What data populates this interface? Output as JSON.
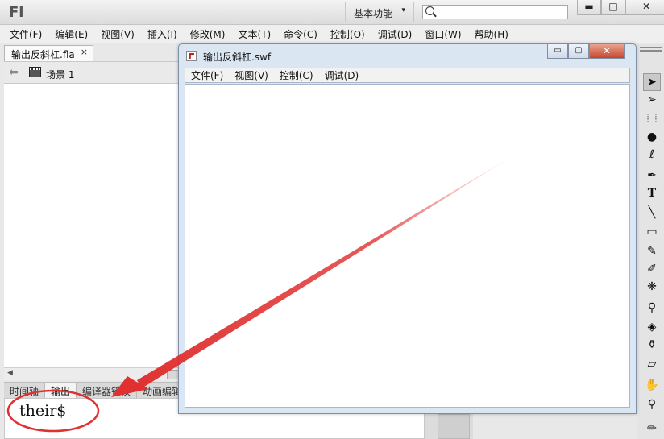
{
  "app": {
    "logo": "Fl",
    "workspace_label": "基本功能",
    "workspace_arrow": "▾",
    "search_placeholder": "",
    "window_buttons": {
      "minimize": "▬",
      "maximize": "□",
      "close": "✕"
    }
  },
  "menu": [
    "文件(F)",
    "编辑(E)",
    "视图(V)",
    "插入(I)",
    "修改(M)",
    "文本(T)",
    "命令(C)",
    "控制(O)",
    "调试(D)",
    "窗口(W)",
    "帮助(H)"
  ],
  "document": {
    "tab_label": "输出反斜杠.fla",
    "tab_close": "×",
    "scene_label": "场景 1"
  },
  "bottom_panel": {
    "tabs": [
      "时间轴",
      "输出",
      "编译器错误",
      "动画编辑器"
    ],
    "active_tab": "输出",
    "output_text": "their$"
  },
  "swf_window": {
    "title": "输出反斜杠.swf",
    "menu": [
      "文件(F)",
      "视图(V)",
      "控制(C)",
      "调试(D)"
    ],
    "buttons": {
      "minimize": "▭",
      "maximize": "▢",
      "close": "✕"
    }
  },
  "tools": [
    "selection-tool",
    "subselection-tool",
    "free-transform-tool",
    "3d-rotation-tool",
    "lasso-tool",
    "pen-tool",
    "text-tool",
    "line-tool",
    "rectangle-tool",
    "pencil-tool",
    "brush-tool",
    "deco-tool",
    "bone-tool",
    "paint-bucket-tool",
    "eyedropper-tool",
    "eraser-tool",
    "hand-tool",
    "zoom-tool",
    "stroke-color"
  ],
  "colors": {
    "annotation_red": "#e03030",
    "swf_close_red": "#c8462f"
  }
}
